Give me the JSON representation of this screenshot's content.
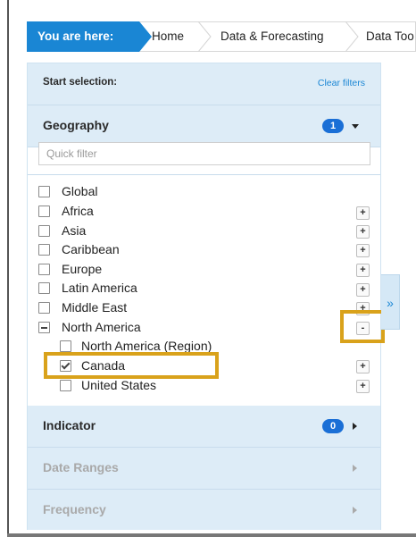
{
  "breadcrumb": {
    "here_label": "You are here:",
    "items": [
      "Home",
      "Data & Forecasting",
      "Data Too"
    ]
  },
  "panel": {
    "start_label": "Start selection:",
    "clear_filters": "Clear filters",
    "geography": {
      "title": "Geography",
      "count": "1",
      "quick_filter_placeholder": "Quick filter",
      "items": [
        {
          "label": "Global",
          "state": "unchecked",
          "button": ""
        },
        {
          "label": "Africa",
          "state": "unchecked",
          "button": "+"
        },
        {
          "label": "Asia",
          "state": "unchecked",
          "button": "+"
        },
        {
          "label": "Caribbean",
          "state": "unchecked",
          "button": "+"
        },
        {
          "label": "Europe",
          "state": "unchecked",
          "button": "+"
        },
        {
          "label": "Latin America",
          "state": "unchecked",
          "button": "+"
        },
        {
          "label": "Middle East",
          "state": "unchecked",
          "button": "+"
        },
        {
          "label": "North America",
          "state": "partial",
          "button": "-"
        },
        {
          "label": "North America (Region)",
          "state": "unchecked",
          "button": ""
        },
        {
          "label": "Canada",
          "state": "checked",
          "button": "+"
        },
        {
          "label": "United States",
          "state": "unchecked",
          "button": "+"
        }
      ]
    },
    "indicator": {
      "title": "Indicator",
      "count": "0"
    },
    "date_ranges": {
      "title": "Date Ranges"
    },
    "frequency": {
      "title": "Frequency"
    }
  },
  "collapse_tab": {
    "glyph": "»"
  },
  "colors": {
    "accent": "#1a86d4",
    "badge": "#1a6fd6",
    "section_bg": "#ddecf7",
    "highlight": "#d9a21b"
  }
}
